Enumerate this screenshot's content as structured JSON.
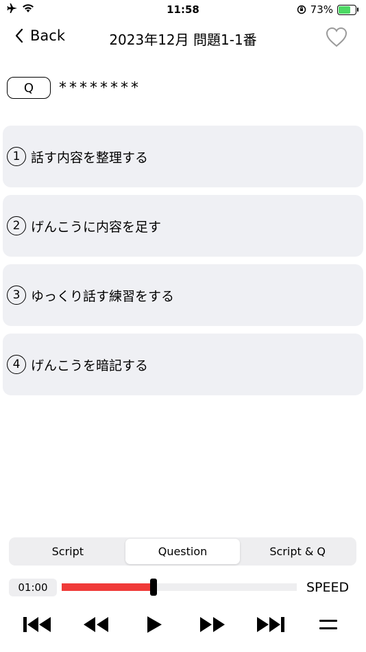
{
  "status_bar": {
    "time": "11:58",
    "battery": "73%",
    "battery_level": 0.73
  },
  "nav": {
    "back_label": "Back",
    "title": "2023年12月 問題1-1番"
  },
  "question": {
    "label": "Q",
    "text": "********"
  },
  "options": [
    {
      "number": "1",
      "label": "話す内容を整理する"
    },
    {
      "number": "2",
      "label": "げんこうに内容を足す"
    },
    {
      "number": "3",
      "label": "ゆっくり話す練習をする"
    },
    {
      "number": "4",
      "label": "げんこうを暗記する"
    }
  ],
  "segments": [
    {
      "label": "Script",
      "active": false
    },
    {
      "label": "Question",
      "active": true
    },
    {
      "label": "Script & Q",
      "active": false
    }
  ],
  "player": {
    "time": "01:00",
    "progress": 0.39,
    "speed_label": "SPEED",
    "played_color": "#f03a38"
  },
  "icons": [
    "airplane-icon",
    "wifi-icon",
    "orientation-lock-icon",
    "battery-icon",
    "chevron-left-icon",
    "heart-icon",
    "skip-start-icon",
    "rewind-icon",
    "play-icon",
    "fast-forward-icon",
    "skip-end-icon",
    "menu-icon"
  ]
}
